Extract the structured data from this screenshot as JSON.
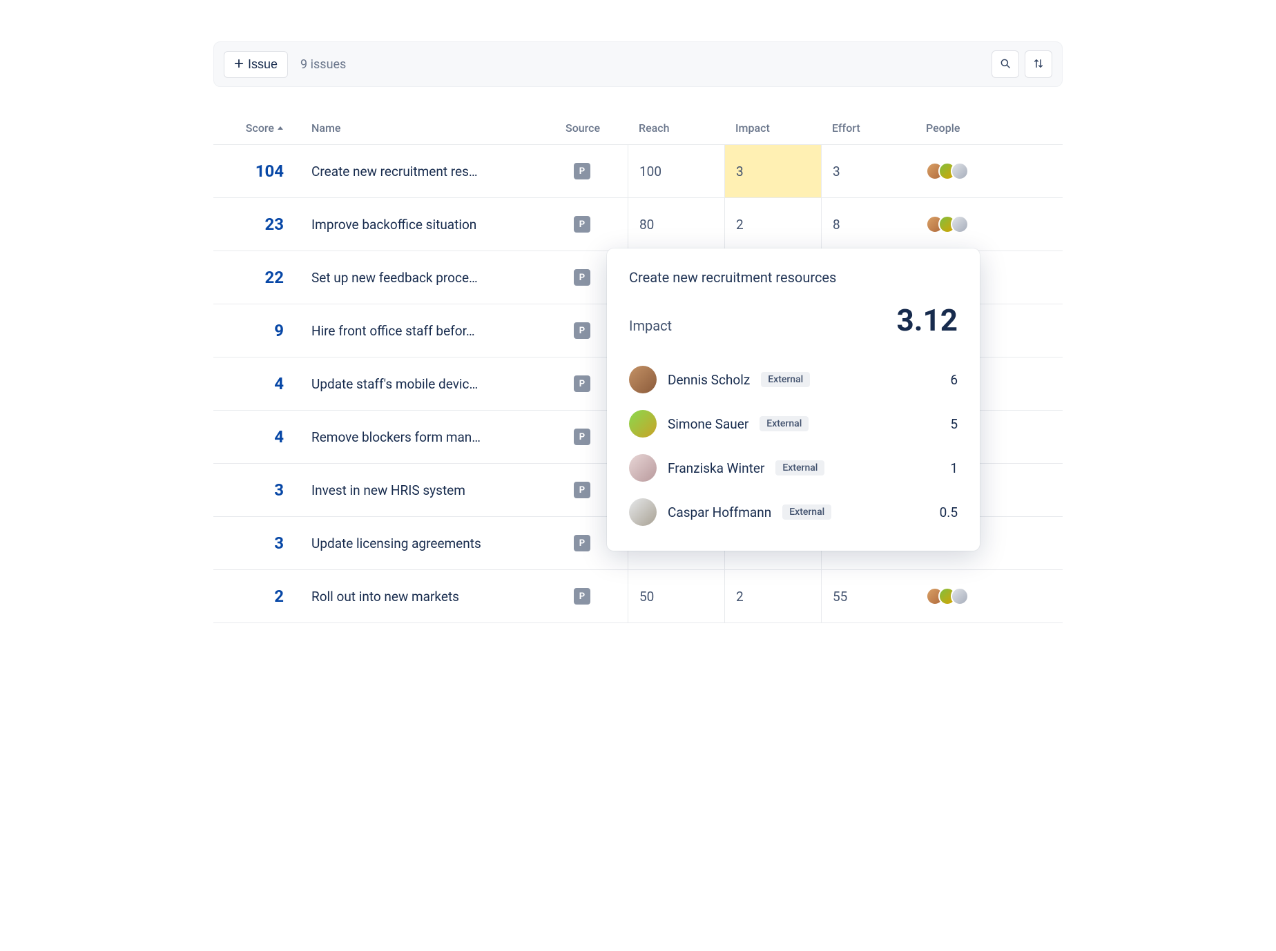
{
  "toolbar": {
    "newIssueLabel": "Issue",
    "countText": "9 issues"
  },
  "columns": {
    "score": "Score",
    "name": "Name",
    "source": "Source",
    "reach": "Reach",
    "impact": "Impact",
    "effort": "Effort",
    "people": "People"
  },
  "rows": [
    {
      "score": "104",
      "name": "Create new recruitment res…",
      "source": "P",
      "reach": "100",
      "impact": "3",
      "effort": "3",
      "impactHighlighted": true,
      "showPeople": true
    },
    {
      "score": "23",
      "name": "Improve backoffice situation",
      "source": "P",
      "reach": "80",
      "impact": "2",
      "effort": "8",
      "showPeople": true
    },
    {
      "score": "22",
      "name": "Set up new feedback proce…",
      "source": "P"
    },
    {
      "score": "9",
      "name": "Hire front office staff befor…",
      "source": "P"
    },
    {
      "score": "4",
      "name": "Update staff's mobile devic…",
      "source": "P"
    },
    {
      "score": "4",
      "name": "Remove blockers form man…",
      "source": "P"
    },
    {
      "score": "3",
      "name": "Invest in new HRIS system",
      "source": "P"
    },
    {
      "score": "3",
      "name": "Update licensing agreements",
      "source": "P"
    },
    {
      "score": "2",
      "name": "Roll out into new markets",
      "source": "P",
      "reach": "50",
      "impact": "2",
      "effort": "55",
      "showPeople": true
    }
  ],
  "popover": {
    "title": "Create new recruitment resources",
    "metricLabel": "Impact",
    "metricValue": "3.12",
    "externalLabel": "External",
    "contributors": [
      {
        "name": "Dennis Scholz",
        "badge": "External",
        "value": "6",
        "avClass": "cv1"
      },
      {
        "name": "Simone Sauer",
        "badge": "External",
        "value": "5",
        "avClass": "cv2"
      },
      {
        "name": "Franziska Winter",
        "badge": "External",
        "value": "1",
        "avClass": "cv3"
      },
      {
        "name": "Caspar Hoffmann",
        "badge": "External",
        "value": "0.5",
        "avClass": "cv4"
      }
    ]
  }
}
